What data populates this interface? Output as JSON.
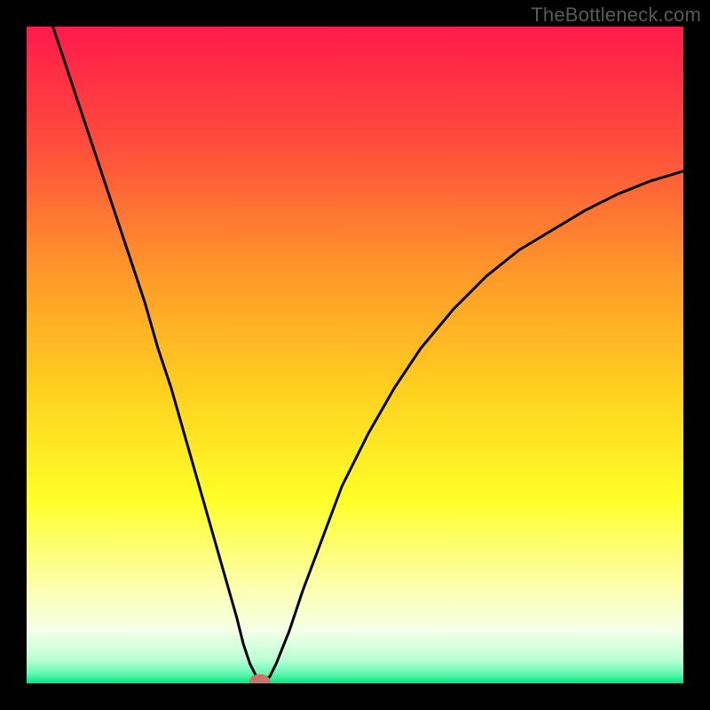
{
  "watermark": "TheBottleneck.com",
  "chart_data": {
    "type": "line",
    "title": "",
    "xlabel": "",
    "ylabel": "",
    "xlim": [
      0,
      100
    ],
    "ylim": [
      0,
      100
    ],
    "grid": false,
    "legend": false,
    "background_gradient_stops": [
      {
        "offset": 0.0,
        "color": "#ff1a4b"
      },
      {
        "offset": 0.18,
        "color": "#ff4d3c"
      },
      {
        "offset": 0.38,
        "color": "#ff9a2a"
      },
      {
        "offset": 0.55,
        "color": "#ffcf1f"
      },
      {
        "offset": 0.72,
        "color": "#ffff28"
      },
      {
        "offset": 0.85,
        "color": "#fdffab"
      },
      {
        "offset": 0.92,
        "color": "#f4ffe6"
      },
      {
        "offset": 0.965,
        "color": "#b9ffd6"
      },
      {
        "offset": 0.985,
        "color": "#65f7b0"
      },
      {
        "offset": 1.0,
        "color": "#00e584"
      }
    ],
    "series": [
      {
        "name": "bottleneck-curve",
        "stroke": "#000000",
        "stroke_width": 3,
        "x": [
          4,
          6,
          8,
          10,
          12,
          14,
          16,
          18,
          20,
          22,
          24,
          26,
          28,
          30,
          32,
          33,
          34,
          35,
          36,
          37,
          38,
          40,
          42,
          45,
          48,
          52,
          56,
          60,
          65,
          70,
          75,
          80,
          85,
          90,
          95,
          100
        ],
        "y": [
          100,
          94,
          88,
          82,
          76,
          70,
          64,
          58,
          51,
          45,
          38,
          31,
          24,
          17,
          10,
          6,
          3,
          1,
          0.5,
          1,
          3,
          8,
          14,
          22,
          30,
          38,
          45,
          51,
          57,
          62,
          66,
          69,
          72,
          74.5,
          76.5,
          78
        ]
      }
    ],
    "marker": {
      "name": "optimum-point",
      "x": 35.5,
      "y": 0.3,
      "rx": 1.6,
      "ry": 1.1,
      "fill": "#c9736b"
    }
  }
}
